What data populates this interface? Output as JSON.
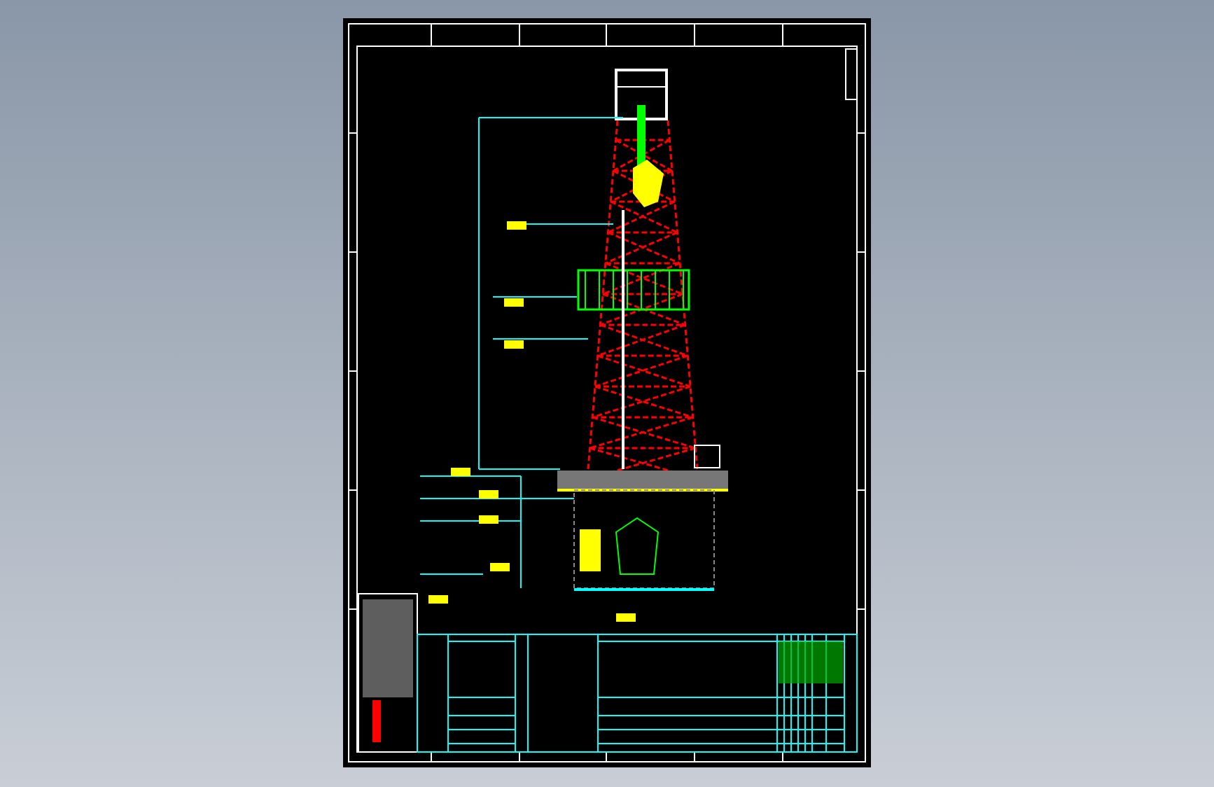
{
  "viewer": {
    "kind": "cad-preview"
  }
}
